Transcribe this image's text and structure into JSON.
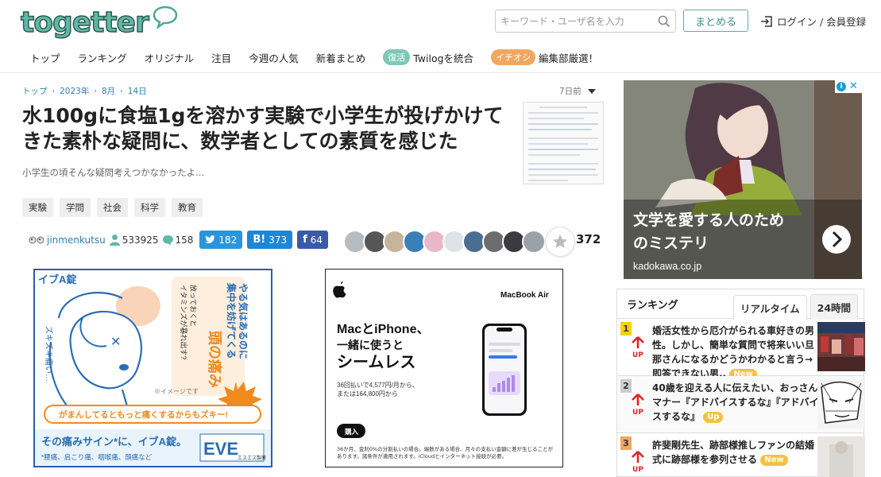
{
  "header": {
    "logo": "togetter",
    "search_placeholder": "キーワード・ユーザ名を入力",
    "matome_button": "まとめる",
    "login_link": "ログイン / 会員登録"
  },
  "nav": {
    "items": [
      "トップ",
      "ランキング",
      "オリジナル",
      "注目",
      "今週の人気",
      "新着まとめ"
    ],
    "twilog_badge": "復活",
    "twilog_label": "Twilogを統合",
    "editor_badge": "イチオシ",
    "editor_label": "編集部厳選！"
  },
  "article": {
    "breadcrumb": [
      "トップ",
      "2023年",
      "8月",
      "14日"
    ],
    "time_ago": "7日前",
    "title": "水100gに食塩1gを溶かす実験で小学生が投げかけてきた素朴な疑問に、数学者としての素質を感じた",
    "subtitle": "小学生の頃そんな疑問考えつかなかったよ...",
    "tags": [
      "実験",
      "学問",
      "社会",
      "科学",
      "教育"
    ],
    "author": "jinmenkutsu",
    "views": "533925",
    "comments": "158",
    "twitter_count": "182",
    "hatena_count": "373",
    "facebook_count": "64",
    "favorite_count": "372"
  },
  "ad_eve": {
    "brand": "イブA錠",
    "side_text": "ズキズキ痛い…",
    "vertical_1": "放っておくと",
    "vertical_2": "イタミンズが暴れ出す?",
    "vertical_3": "やる気はあるのに",
    "vertical_4": "集中を妨げてくる",
    "headache": "頭の痛み",
    "note": "※イメージです",
    "warning": "がまんしてるともっと痛くするからもズキー!",
    "tagline": "その痛みサイン*に、イブA錠。",
    "footnote": "*腰痛、肩こり痛、咽喉痛、頭痛など",
    "product": "EVE",
    "maker": "エスエス製薬"
  },
  "ad_mac": {
    "product": "MacBook Air",
    "headline_1": "MacとiPhone、",
    "headline_2": "一緒に使うと",
    "headline_3": "シームレス",
    "price_1": "36回払いで4,577円/月から、",
    "price_2": "または164,800円から",
    "buy_button": "購入",
    "fine_print": "36か月、金利0%の分割払いの場合。端数がある場合、月々の支払い金額に差が生じることがあります。諸条件が適用されます。iCloudとインターネット接続が必要。"
  },
  "ad_side": {
    "headline_1": "文学を愛する人のため",
    "headline_2": "のミステリ",
    "domain": "kadokawa.co.jp"
  },
  "ranking": {
    "title": "ランキング",
    "tab_realtime": "リアルタイム",
    "tab_24h": "24時間",
    "up_label": "UP",
    "items": [
      {
        "rank": "1",
        "text": "婚活女性から厄介がられる車好きの男性。しかし、簡単な質問で将来いい旦那さんになるかどうかわかると言う→即答できない男..",
        "badge": "New",
        "num_color": "#f5d20a"
      },
      {
        "rank": "2",
        "text": "40歳を迎える人に伝えたい、おっさんマナー『アドバイスするな』『アドバイスするな』",
        "badge": "Up",
        "num_color": "#cccccc"
      },
      {
        "rank": "3",
        "text": "許斐剛先生、跡部様推しファンの結婚式に跡部様を参列させる",
        "badge": "New",
        "num_color": "#f0a860"
      }
    ]
  },
  "colors": {
    "accent": "#5fb9a7",
    "link": "#2f7fb0",
    "twitter": "#2a95dc",
    "hatena": "#1e86d8",
    "facebook": "#3a5aa8"
  }
}
